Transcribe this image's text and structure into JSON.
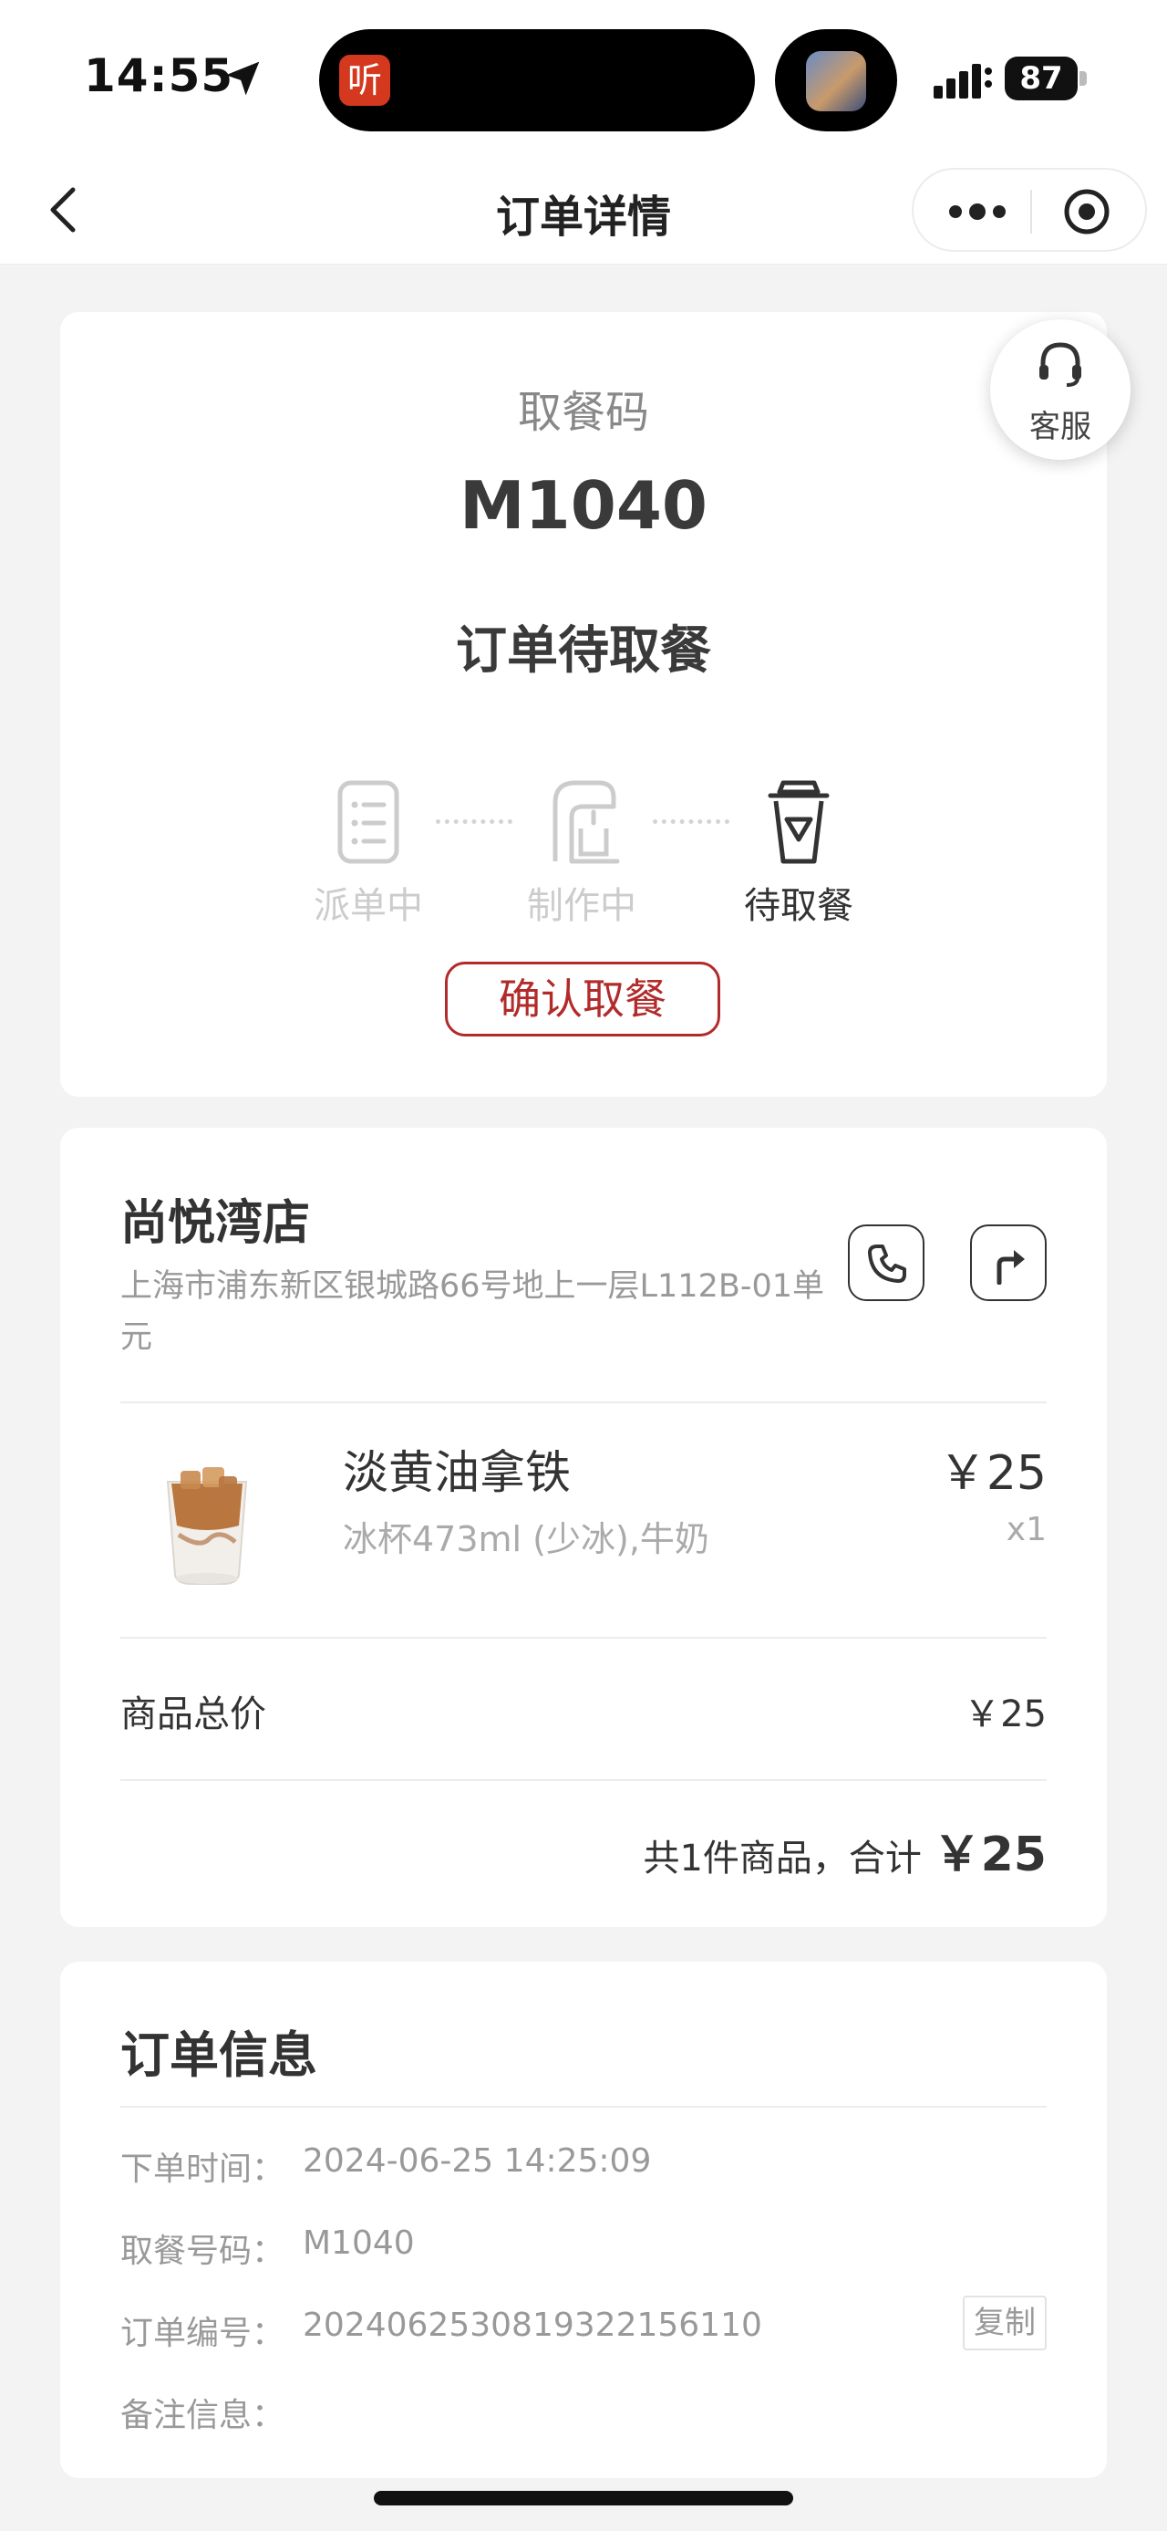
{
  "status_bar": {
    "time": "14:55",
    "island_app_glyph": "听",
    "battery": "87",
    "icons": [
      "location-arrow-icon",
      "signal-icon",
      "battery-icon"
    ]
  },
  "nav": {
    "title": "订单详情",
    "icons": [
      "back-icon",
      "more-icon",
      "close-target-icon"
    ]
  },
  "status_card": {
    "pickup_label": "取餐码",
    "pickup_code": "M1040",
    "order_status": "订单待取餐",
    "steps": [
      {
        "label": "派单中",
        "icon": "list-icon",
        "active": false
      },
      {
        "label": "制作中",
        "icon": "coffee-machine-icon",
        "active": false
      },
      {
        "label": "待取餐",
        "icon": "cup-icon",
        "active": true
      }
    ],
    "confirm_button": "确认取餐",
    "service_label": "客服",
    "colors": {
      "accent": "#b22b2b",
      "inactive": "#cccccc",
      "active": "#333333"
    }
  },
  "store": {
    "name": "尚悦湾店",
    "address": "上海市浦东新区银城路66号地上一层L112B-01单元",
    "product": {
      "name": "淡黄油拿铁",
      "spec": "冰杯473ml (少冰),牛奶",
      "price": "￥25",
      "qty": "x1"
    },
    "subtotal_label": "商品总价",
    "subtotal_value": "￥25",
    "total_prefix": "共1件商品，合计",
    "total_amount": "￥25"
  },
  "order_info": {
    "title": "订单信息",
    "rows": [
      {
        "label": "下单时间：",
        "value": "2024-06-25 14:25:09"
      },
      {
        "label": "取餐号码：",
        "value": "M1040"
      },
      {
        "label": "订单编号：",
        "value": "20240625308193221561​10"
      },
      {
        "label": "备注信息：",
        "value": ""
      }
    ],
    "copy_button": "复制"
  }
}
